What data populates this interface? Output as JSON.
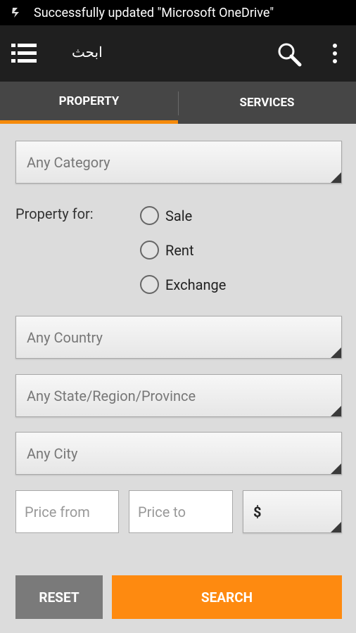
{
  "status_bar": {
    "notification": "Successfully updated \"Microsoft OneDrive\""
  },
  "app_bar": {
    "title": "ابحث"
  },
  "tabs": [
    {
      "label": "PROPERTY",
      "active": true
    },
    {
      "label": "SERVICES",
      "active": false
    }
  ],
  "form": {
    "category": "Any Category",
    "property_for_label": "Property for:",
    "property_for_options": [
      "Sale",
      "Rent",
      "Exchange"
    ],
    "country": "Any Country",
    "state": "Any State/Region/Province",
    "city": "Any City",
    "price_from_placeholder": "Price from",
    "price_to_placeholder": "Price to",
    "currency": "$"
  },
  "buttons": {
    "reset": "RESET",
    "search": "SEARCH"
  },
  "colors": {
    "accent": "#fe8a10",
    "app_bar": "#1f1f1f",
    "tabs_bg": "#464646",
    "background": "#dcdcdc"
  }
}
